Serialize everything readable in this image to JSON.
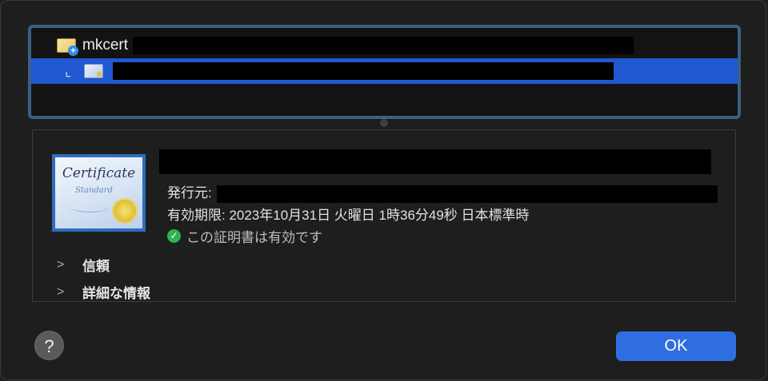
{
  "chain": {
    "root_label": "mkcert",
    "tree_arrow": "⌞→"
  },
  "details": {
    "issuer_label": "発行元:",
    "expiry_label": "有効期限: 2023年10月31日 火曜日 1時36分49秒 日本標準時",
    "status_text": "この証明書は有効です",
    "trust_label": "信頼",
    "detail_label": "詳細な情報",
    "cert_title": "Certificate",
    "cert_sub": "Standard"
  },
  "buttons": {
    "help_label": "?",
    "ok_label": "OK"
  },
  "colors": {
    "selection": "#1f58d0",
    "accent_button": "#2f6ee0",
    "valid_check": "#2fb24f"
  }
}
